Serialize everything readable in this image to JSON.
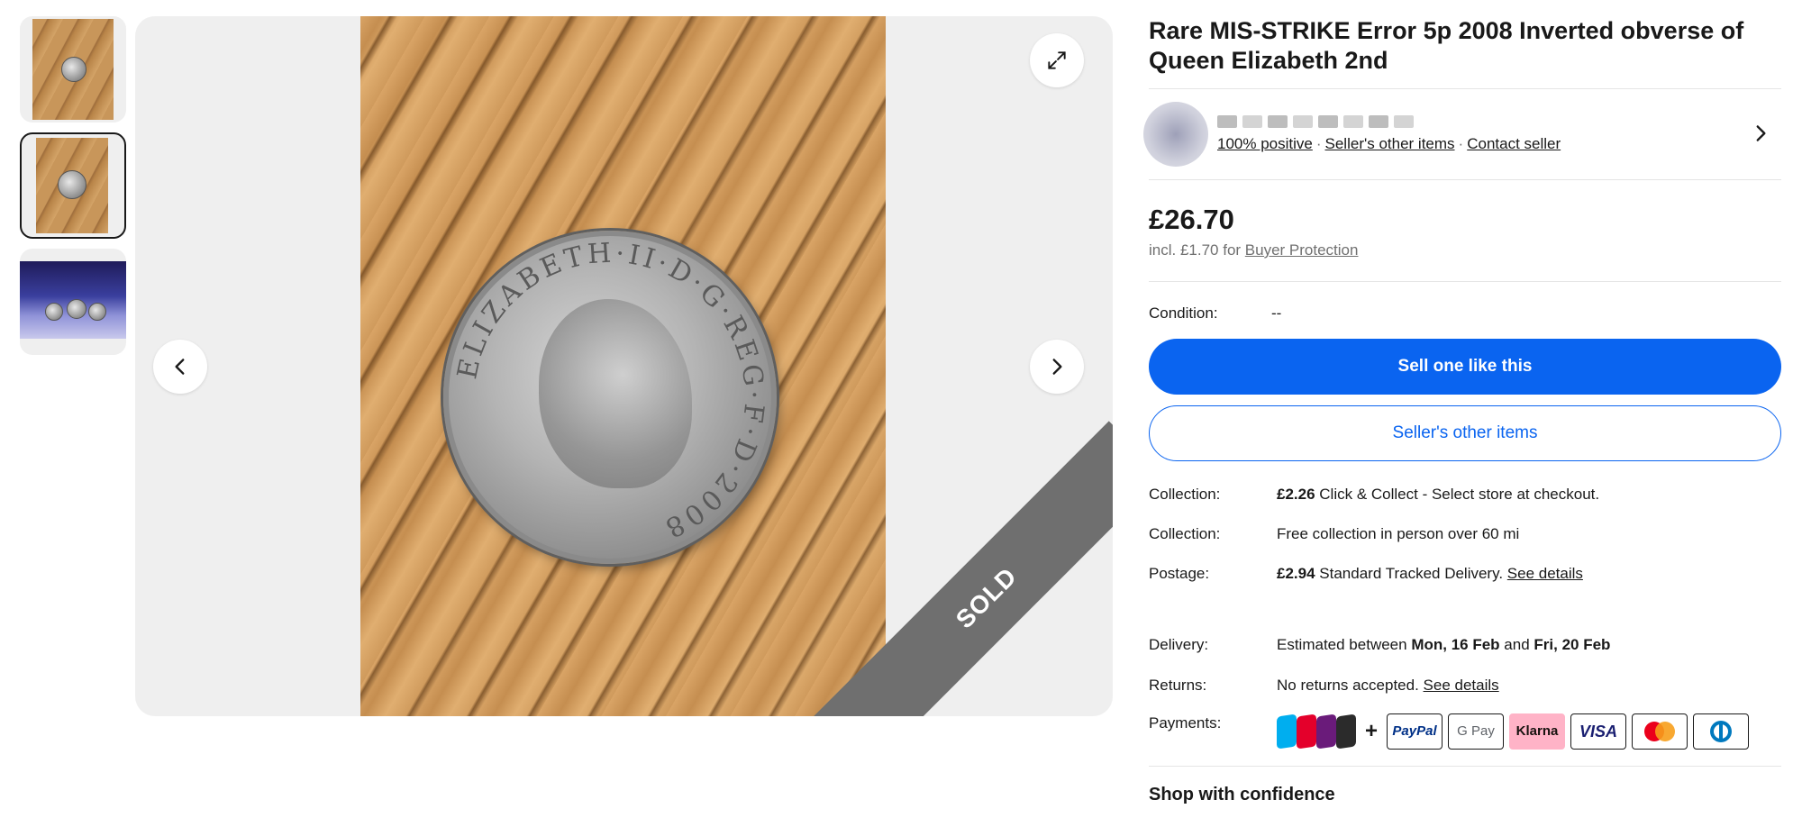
{
  "listing": {
    "title": "Rare MIS-STRIKE Error 5p 2008 Inverted obverse of Queen Elizabeth 2nd",
    "sold_label": "SOLD",
    "coin_legend": "ELIZABETH·II·D·G·REG·F·D·2008"
  },
  "seller": {
    "positive": "100% positive",
    "other_items": "Seller's other items",
    "contact": "Contact seller"
  },
  "price": {
    "amount": "£26.70",
    "incl_prefix": "incl. £1.70 for",
    "buyer_protection": "Buyer Protection"
  },
  "condition": {
    "label": "Condition:",
    "value": "--"
  },
  "buttons": {
    "sell_like": "Sell one like this",
    "seller_other_items": "Seller's other items"
  },
  "details": {
    "collection1": {
      "label": "Collection:",
      "price": "£2.26",
      "text": "Click & Collect - Select store at checkout."
    },
    "collection2": {
      "label": "Collection:",
      "text": "Free collection in person over 60 mi"
    },
    "postage": {
      "label": "Postage:",
      "price": "£2.94",
      "text": "Standard Tracked Delivery.",
      "link": "See details"
    },
    "delivery": {
      "label": "Delivery:",
      "prefix": "Estimated between",
      "from": "Mon, 16 Feb",
      "and": "and",
      "to": "Fri, 20 Feb"
    },
    "returns": {
      "label": "Returns:",
      "text": "No returns accepted.",
      "link": "See details"
    },
    "payments": {
      "label": "Payments:",
      "plus": "+",
      "methods": [
        "PayPal",
        "G Pay",
        "Klarna",
        "VISA"
      ]
    }
  },
  "shop_confidence": "Shop with confidence",
  "colors": {
    "primary": "#0a64f0",
    "klarna": "#ffb3c7",
    "visa": "#1a1f71",
    "sold_band": "#6f6f6f"
  },
  "icons": [
    "expand-icon",
    "chevron-left-icon",
    "chevron-right-icon",
    "chevron-right-icon"
  ]
}
